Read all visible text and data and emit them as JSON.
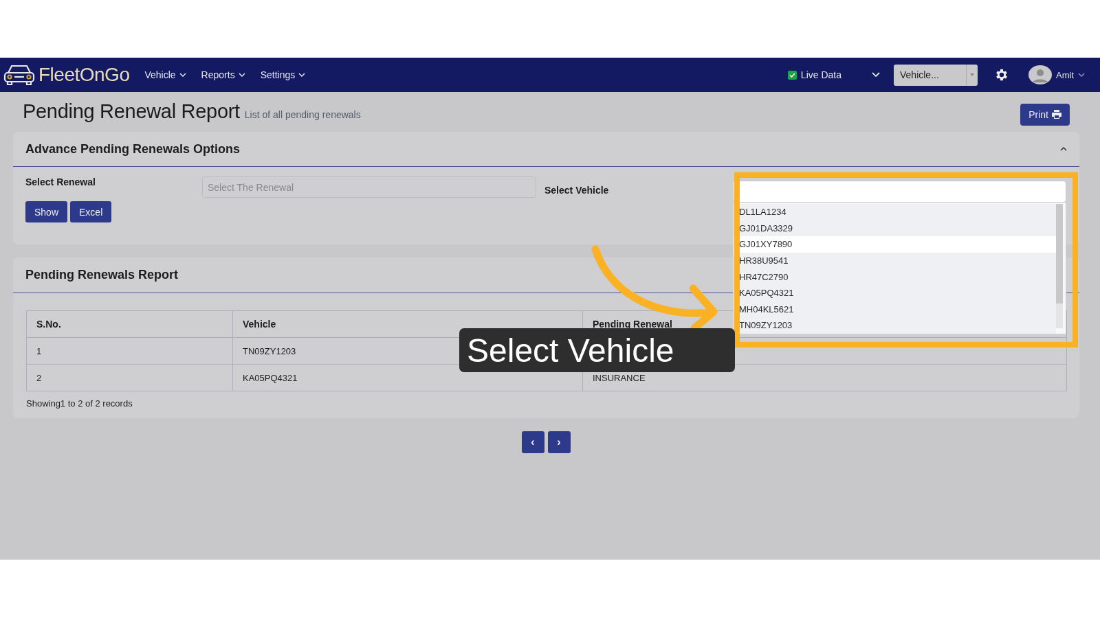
{
  "nav": {
    "logo": "FleetOnGo",
    "menus": [
      {
        "label": "Vehicle"
      },
      {
        "label": "Reports"
      },
      {
        "label": "Settings"
      }
    ],
    "live_data": {
      "label": "Live Data",
      "checked": true
    },
    "vehicle_select": {
      "value": "Vehicle..."
    },
    "user": {
      "name": "Amit"
    }
  },
  "header": {
    "title": "Pending Renewal Report",
    "subtitle": "List of all pending renewals",
    "print_button": "Print"
  },
  "options_card": {
    "title": "Advance Pending Renewals Options",
    "expanded": true,
    "renewal": {
      "label": "Select Renewal",
      "placeholder": "Select The Renewal"
    },
    "vehicle": {
      "label": "Select Vehicle",
      "options": [
        {
          "label": "DL1LA1234",
          "selected": false
        },
        {
          "label": "GJ01DA3329",
          "selected": false
        },
        {
          "label": "GJ01XY7890",
          "selected": true
        },
        {
          "label": "HR38U9541",
          "selected": false
        },
        {
          "label": "HR47C2790",
          "selected": false
        },
        {
          "label": "KA05PQ4321",
          "selected": false
        },
        {
          "label": "MH04KL5621",
          "selected": false
        },
        {
          "label": "TN09ZY1203",
          "selected": false
        }
      ]
    },
    "buttons": [
      "Show",
      "Excel"
    ]
  },
  "report_card": {
    "title": "Pending Renewals Report",
    "table": {
      "columns": [
        "S.No.",
        "Vehicle",
        "Pending Renewal"
      ],
      "rows": [
        [
          "1",
          "TN09ZY1203"
        ],
        [
          "2",
          "KA05PQ4321",
          "INSURANCE"
        ]
      ]
    },
    "footer": "Showing1 to 2 of 2 records",
    "pagination": [
      "‹",
      "›"
    ]
  },
  "callout": {
    "text": "Select Vehicle"
  }
}
